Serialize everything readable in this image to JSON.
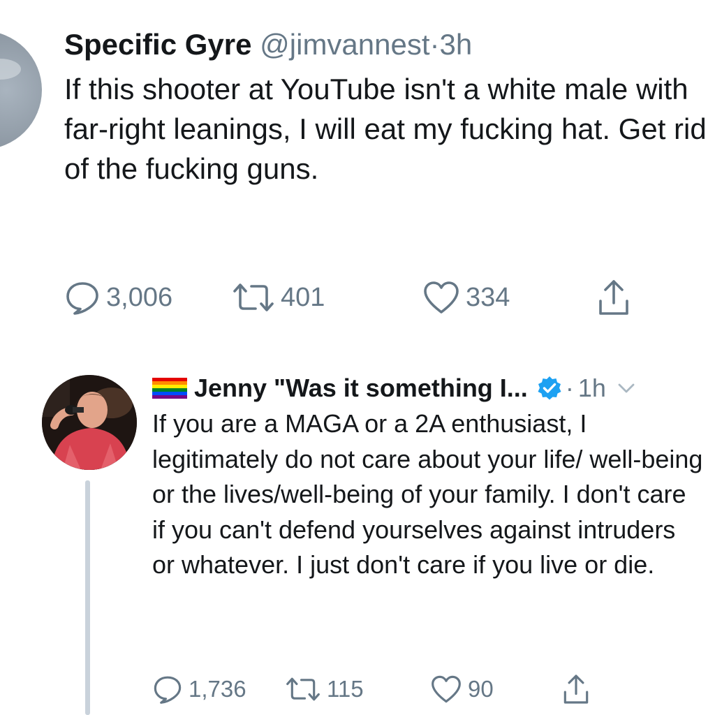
{
  "tweet1": {
    "display_name": "Specific Gyre",
    "handle": "@jimvannest",
    "separator": "·",
    "time": "3h",
    "text": "If this shooter at YouTube isn't a white male with far-right leanings, I will eat my fucking hat. Get rid of the fucking guns.",
    "replies": "3,006",
    "retweets": "401",
    "likes": "334",
    "icons": {
      "reply": "reply-icon",
      "retweet": "retweet-icon",
      "like": "heart-icon",
      "share": "share-icon"
    }
  },
  "tweet2": {
    "display_name": "Jenny \"Was it something I...",
    "flag": "rainbow-flag",
    "flag_colors": [
      "#e40303",
      "#ff8c00",
      "#ffed00",
      "#008026",
      "#004dff",
      "#750787"
    ],
    "verified": true,
    "separator": "·",
    "time": "1h",
    "text": "If you are a MAGA or a 2A enthusiast, I legitimately do not care about your life/ well-being or the lives/well-being of your family. I don't care if you can't defend yourselves against intruders or whatever. I just don't care if you live or die.",
    "replies": "1,736",
    "retweets": "115",
    "likes": "90",
    "icons": {
      "reply": "reply-icon",
      "retweet": "retweet-icon",
      "like": "heart-icon",
      "share": "share-icon",
      "more": "chevron-down-icon",
      "verified": "verified-badge-icon"
    }
  },
  "colors": {
    "text": "#14171a",
    "secondary": "#657786",
    "verified_blue": "#1da1f2",
    "thread_line": "#c9d2db"
  }
}
